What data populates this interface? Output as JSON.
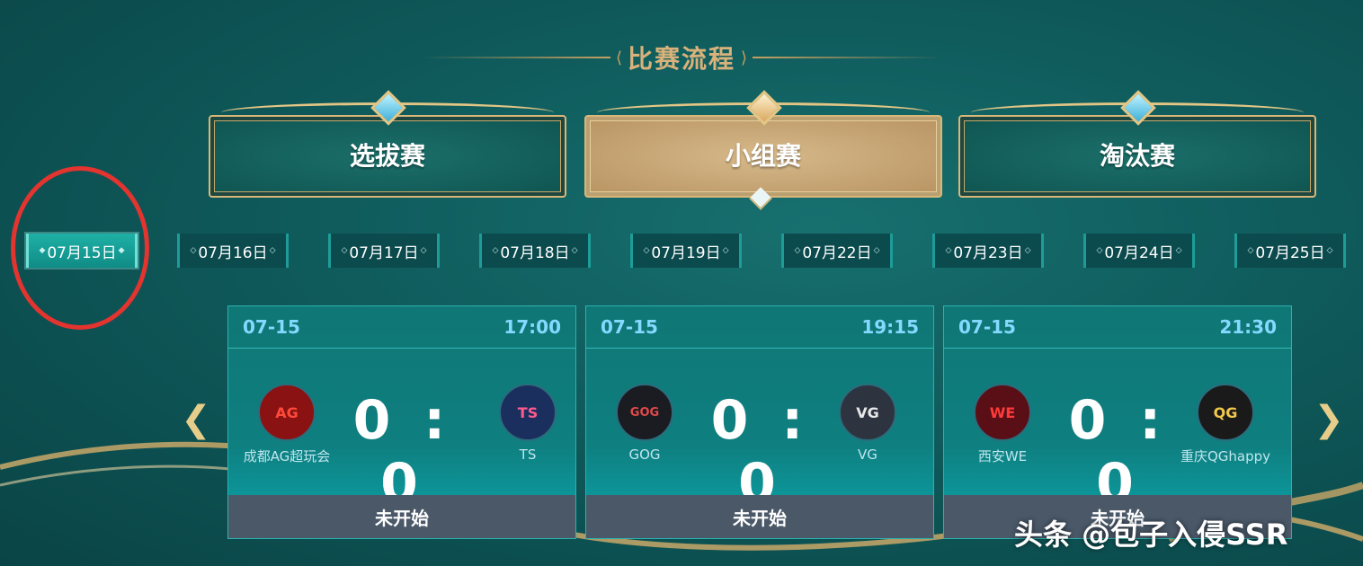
{
  "header": {
    "title": "比赛流程"
  },
  "stages": [
    {
      "label": "选拔赛",
      "active": false
    },
    {
      "label": "小组赛",
      "active": true
    },
    {
      "label": "淘汰赛",
      "active": false
    }
  ],
  "dates": [
    {
      "label": "07月15日",
      "active": true
    },
    {
      "label": "07月16日",
      "active": false
    },
    {
      "label": "07月17日",
      "active": false
    },
    {
      "label": "07月18日",
      "active": false
    },
    {
      "label": "07月19日",
      "active": false
    },
    {
      "label": "07月22日",
      "active": false
    },
    {
      "label": "07月23日",
      "active": false
    },
    {
      "label": "07月24日",
      "active": false
    },
    {
      "label": "07月25日",
      "active": false
    }
  ],
  "matches": [
    {
      "date": "07-15",
      "time": "17:00",
      "team1": "成都AG超玩会",
      "team1_logo": "AG",
      "score": "0 : 0",
      "team2": "TS",
      "team2_logo": "TS",
      "status": "未开始"
    },
    {
      "date": "07-15",
      "time": "19:15",
      "team1": "GOG",
      "team1_logo": "GOG",
      "score": "0 : 0",
      "team2": "VG",
      "team2_logo": "VG",
      "status": "未开始"
    },
    {
      "date": "07-15",
      "time": "21:30",
      "team1": "西安WE",
      "team1_logo": "WE",
      "score": "0 : 0",
      "team2": "重庆QGhappy",
      "team2_logo": "QG",
      "status": "未开始"
    }
  ],
  "nav": {
    "prev_icon": "chevron-left-icon",
    "next_icon": "chevron-right-icon"
  },
  "watermark": "头条 @包子入侵SSR",
  "colors": {
    "accent_gold": "#d8b27a",
    "highlight_red": "#e3342f",
    "card_status": "#4a5868"
  }
}
